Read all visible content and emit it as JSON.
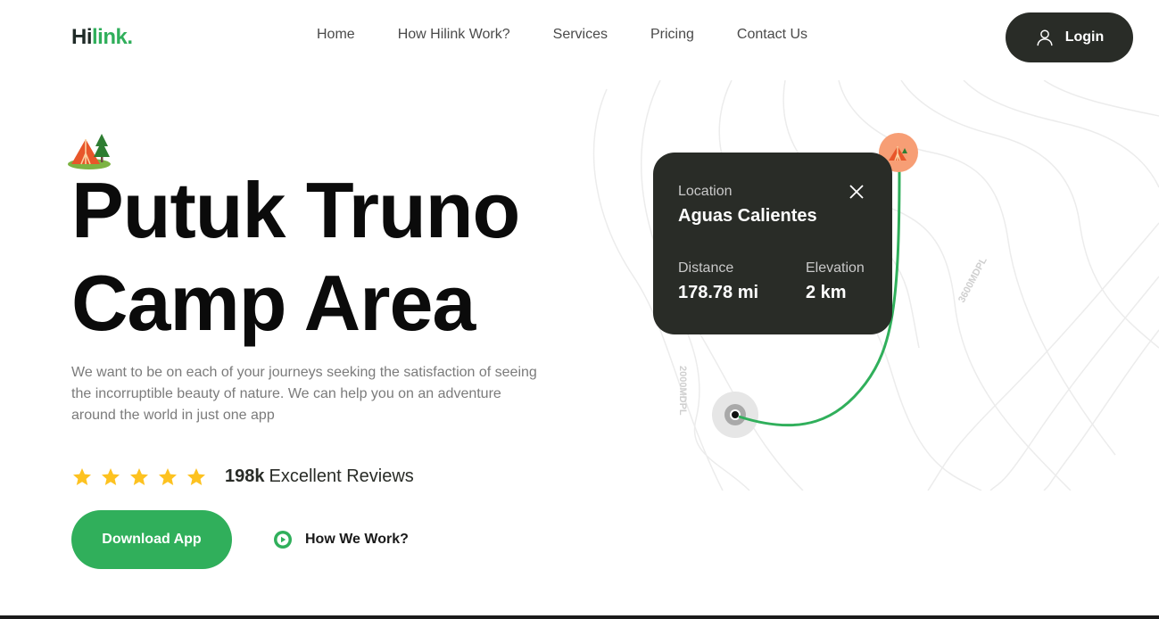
{
  "header": {
    "logo_part1": "Hi",
    "logo_part2": "link.",
    "nav": [
      "Home",
      "How Hilink Work?",
      "Services",
      "Pricing",
      "Contact Us"
    ],
    "login_label": "Login"
  },
  "hero": {
    "title_line1": "Putuk Truno",
    "title_line2": "Camp Area",
    "description": "We want to be on each of your journeys seeking the satisfaction of seeing the incorruptible beauty of nature. We can help you on an adventure around the world in just one app",
    "rating_stars": 5,
    "reviews_count": "198k",
    "reviews_label": "Excellent Reviews",
    "download_label": "Download App",
    "how_label": "How We Work?"
  },
  "map": {
    "contour_label_1": "3600MDPL",
    "contour_label_2": "2000MDPL",
    "card": {
      "location_label": "Location",
      "location_value": "Aguas Calientes",
      "distance_label": "Distance",
      "distance_value": "178.78 mi",
      "elevation_label": "Elevation",
      "elevation_value": "2 km"
    }
  },
  "colors": {
    "brand_green": "#30af5b",
    "dark": "#292c27",
    "star": "#fdc220",
    "pin": "#f79e75"
  },
  "icons": [
    "user-icon",
    "tent-icon",
    "star-icon",
    "play-icon",
    "close-icon",
    "location-pin-icon"
  ]
}
